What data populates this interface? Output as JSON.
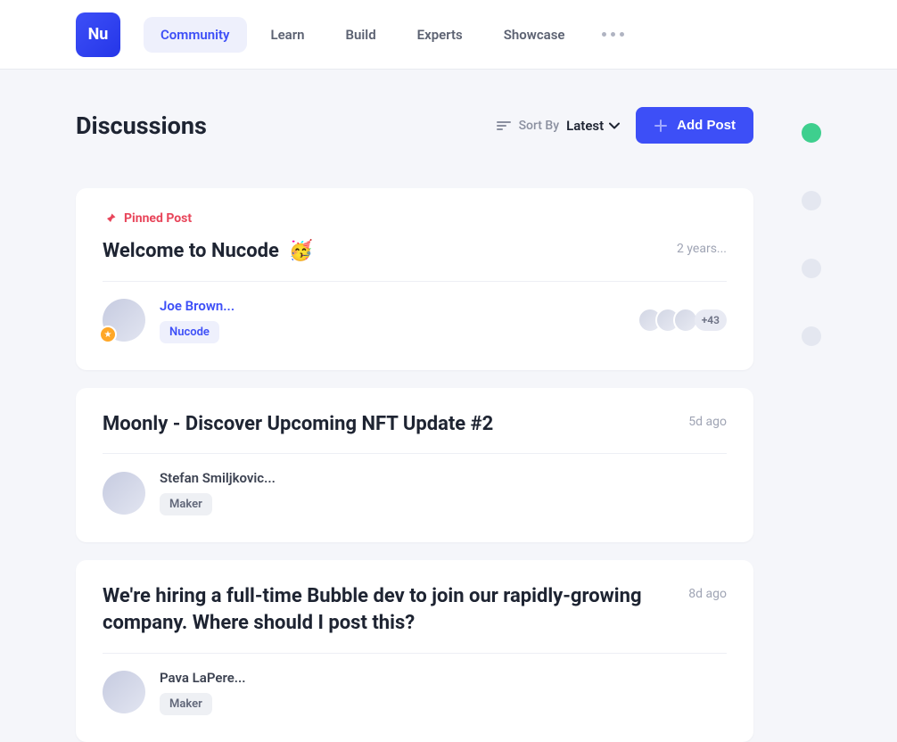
{
  "logo": "Nu",
  "nav": {
    "items": [
      {
        "label": "Community",
        "active": true
      },
      {
        "label": "Learn",
        "active": false
      },
      {
        "label": "Build",
        "active": false
      },
      {
        "label": "Experts",
        "active": false
      },
      {
        "label": "Showcase",
        "active": false
      }
    ]
  },
  "page_title": "Discussions",
  "sort": {
    "label": "Sort By",
    "value": "Latest"
  },
  "add_post_label": "Add Post",
  "pinned_label": "Pinned Post",
  "posts": [
    {
      "pinned": true,
      "title": "Welcome to Nucode",
      "emoji": "🥳",
      "time": "2 years...",
      "author": "Joe Brown...",
      "author_link": true,
      "tag": "Nucode",
      "tag_style": "blue",
      "participants_more": "+43"
    },
    {
      "pinned": false,
      "title": "Moonly - Discover Upcoming NFT Update #2",
      "emoji": "",
      "time": "5d ago",
      "author": "Stefan Smiljkovic...",
      "author_link": false,
      "tag": "Maker",
      "tag_style": "grey",
      "participants_more": ""
    },
    {
      "pinned": false,
      "title": "We're hiring a full-time Bubble dev to join our rapidly-growing company. Where should I post this?",
      "emoji": "",
      "time": "8d ago",
      "author": "Pava LaPere...",
      "author_link": false,
      "tag": "Maker",
      "tag_style": "grey",
      "participants_more": ""
    }
  ]
}
